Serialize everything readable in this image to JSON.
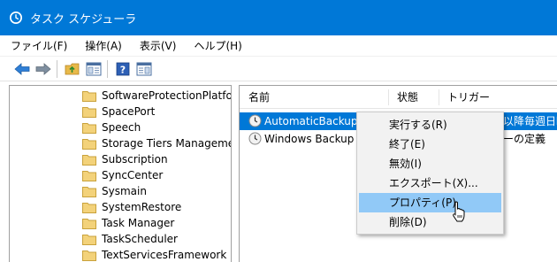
{
  "window": {
    "title": "タスク スケジューラ",
    "accent": "#0078d7"
  },
  "menu": [
    "ファイル(F)",
    "操作(A)",
    "表示(V)",
    "ヘルプ(H)"
  ],
  "toolbar": [
    {
      "icon": "back-arrow-icon"
    },
    {
      "icon": "forward-arrow-icon"
    },
    {
      "icon": "up-folder-icon"
    },
    {
      "icon": "show-hide-console-tree-icon"
    },
    {
      "icon": "help-icon"
    },
    {
      "icon": "show-hide-action-pane-icon"
    }
  ],
  "tree": {
    "items": [
      "SoftwareProtectionPlatform",
      "SpacePort",
      "Speech",
      "Storage Tiers Management",
      "Subscription",
      "SyncCenter",
      "Sysmain",
      "SystemRestore",
      "Task Manager",
      "TaskScheduler",
      "TextServicesFramework"
    ]
  },
  "list": {
    "columns": [
      "名前",
      "状態",
      "トリガー"
    ],
    "rows": [
      {
        "name": "AutomaticBackup",
        "trigger_fragment": "以降毎週日曜",
        "selected": true
      },
      {
        "name": "Windows Backup Monitor",
        "trigger_fragment": "ーの定義",
        "selected": false
      }
    ]
  },
  "context_menu": {
    "items": [
      {
        "label": "実行する(R)",
        "highlighted": false
      },
      {
        "label": "終了(E)",
        "highlighted": false
      },
      {
        "label": "無効(I)",
        "highlighted": false
      },
      {
        "label": "エクスポート(X)...",
        "highlighted": false
      },
      {
        "label": "プロパティ(P)",
        "highlighted": true
      },
      {
        "label": "削除(D)",
        "highlighted": false
      }
    ]
  }
}
